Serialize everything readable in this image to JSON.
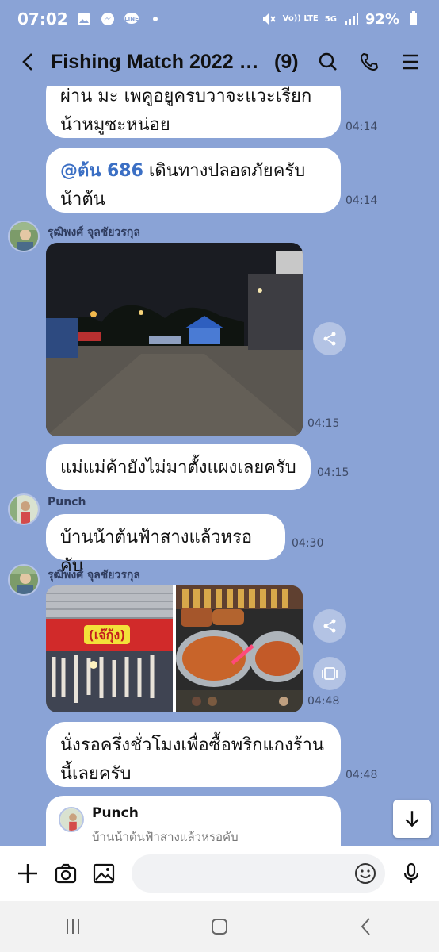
{
  "status": {
    "time": "07:02",
    "battery": "92%",
    "volte": "Vo)) LTE",
    "net": "5G"
  },
  "header": {
    "title": "Fishing Match 2022 ค...",
    "member_count": "(9)"
  },
  "messages": [
    {
      "text": "ผ่าน มะ เพคูอยูครบวาจะแวะเรียก น้าหมูซะหน่อย",
      "time": "04:14"
    },
    {
      "mention": "@ต้น 686",
      "text": " เดินทางปลอดภัยครับน้าต้น",
      "time": "04:14"
    },
    {
      "sender": "รุฒิพงศ์ จุลชัยวรกุล",
      "time": "04:15",
      "caption": "Night parking area photo"
    },
    {
      "text": "แม่แม่ค้ายังไม่มาตั้งแผงเลยครับ",
      "time": "04:15"
    },
    {
      "sender": "Punch",
      "text": "บ้านน้าต้นฟ้าสางแล้วหรอคับ",
      "time": "04:30"
    },
    {
      "sender": "รุฒิพงศ์ จุลชัยวรกุล",
      "time": "04:48",
      "sign": "(เจ๊กุ้ง)"
    },
    {
      "text": "นั่งรอครึ่งชั่วโมงเพื่อซื้อพริกแกงร้านนี้เลยครับ",
      "time": "04:48"
    }
  ],
  "reply_preview": {
    "name": "Punch",
    "quote": "บ้านน้าต้นฟ้าสางแล้วหรอคับ"
  },
  "input": {
    "placeholder": ""
  },
  "colors": {
    "background": "#8aa3d6",
    "mention": "#3b6fc4",
    "bubble": "#ffffff"
  }
}
